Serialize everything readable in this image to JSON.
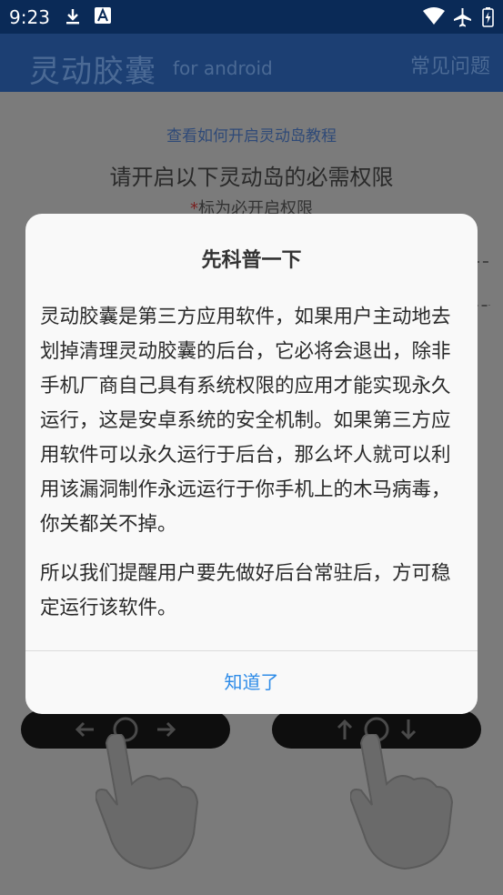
{
  "status_bar": {
    "time": "9:23",
    "icons_left": [
      "download-icon",
      "font-a-icon"
    ],
    "icons_right": [
      "wifi-icon",
      "airplane-icon",
      "battery-charging-icon"
    ]
  },
  "app_bar": {
    "title": "灵动胶囊",
    "subtitle": "for android",
    "faq": "常见问题"
  },
  "background": {
    "tutorial_link": "查看如何开启灵动岛教程",
    "heading": "请开启以下灵动岛的必需权限",
    "note_star": "*",
    "note_text": "标为必开启权限"
  },
  "dialog": {
    "title": "先科普一下",
    "paragraph_1": "灵动胶囊是第三方应用软件，如果用户主动地去划掉清理灵动胶囊的后台，它必将会退出，除非手机厂商自己具有系统权限的应用才能实现永久运行，这是安卓系统的安全机制。如果第三方应用软件可以永久运行于后台，那么坏人就可以利用该漏洞制作永远运行于你手机上的木马病毒，你关都关不掉。",
    "paragraph_2": "所以我们提醒用户要先做好后台常驻后，方可稳定运行该软件。",
    "confirm_button": "知道了"
  },
  "colors": {
    "status_bar_bg": "#0a2a57",
    "dialog_bg": "#f9f9f9",
    "accent_button": "#2f8ce8",
    "scrim": "#7a7a7a"
  }
}
